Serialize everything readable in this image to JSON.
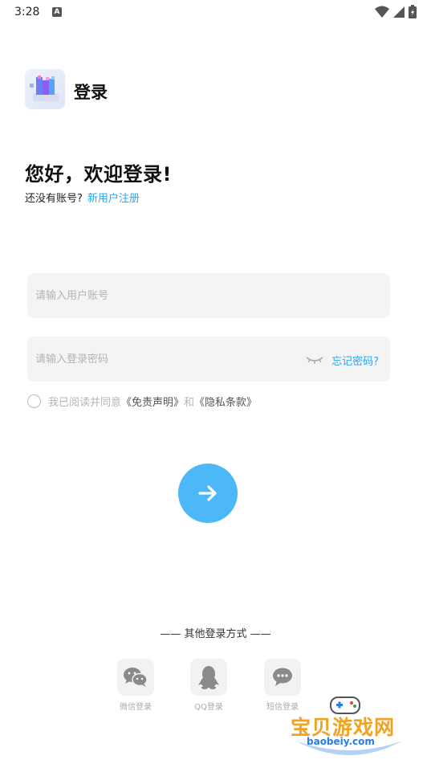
{
  "status_bar": {
    "time": "3:28",
    "a_icon": "A"
  },
  "header": {
    "logo_icon": "cube-logo-icon",
    "title": "登录"
  },
  "greeting": {
    "title": "您好，欢迎登录!",
    "no_account": "还没有账号?",
    "register_link": "新用户注册"
  },
  "form": {
    "username_placeholder": "请输入用户账号",
    "password_placeholder": "请输入登录密码",
    "forgot_link": "忘记密码?",
    "agree_prefix": "我已阅读并同意",
    "disclaimer_doc": "《免责声明》",
    "agree_and": "和",
    "privacy_doc": "《隐私条款》"
  },
  "submit": {
    "icon": "arrow-right-icon",
    "color": "#4db8f8"
  },
  "other_login": {
    "title": "—— 其他登录方式 ——",
    "options": [
      {
        "label": "微信登录",
        "icon": "wechat-icon"
      },
      {
        "label": "QQ登录",
        "icon": "qq-icon"
      },
      {
        "label": "短信登录",
        "icon": "sms-icon"
      }
    ]
  },
  "watermark": {
    "text": "宝贝游戏网",
    "url": "baobeiy.com"
  },
  "colors": {
    "accent": "#2aa6f3",
    "field_bg": "#f4f4f4"
  }
}
